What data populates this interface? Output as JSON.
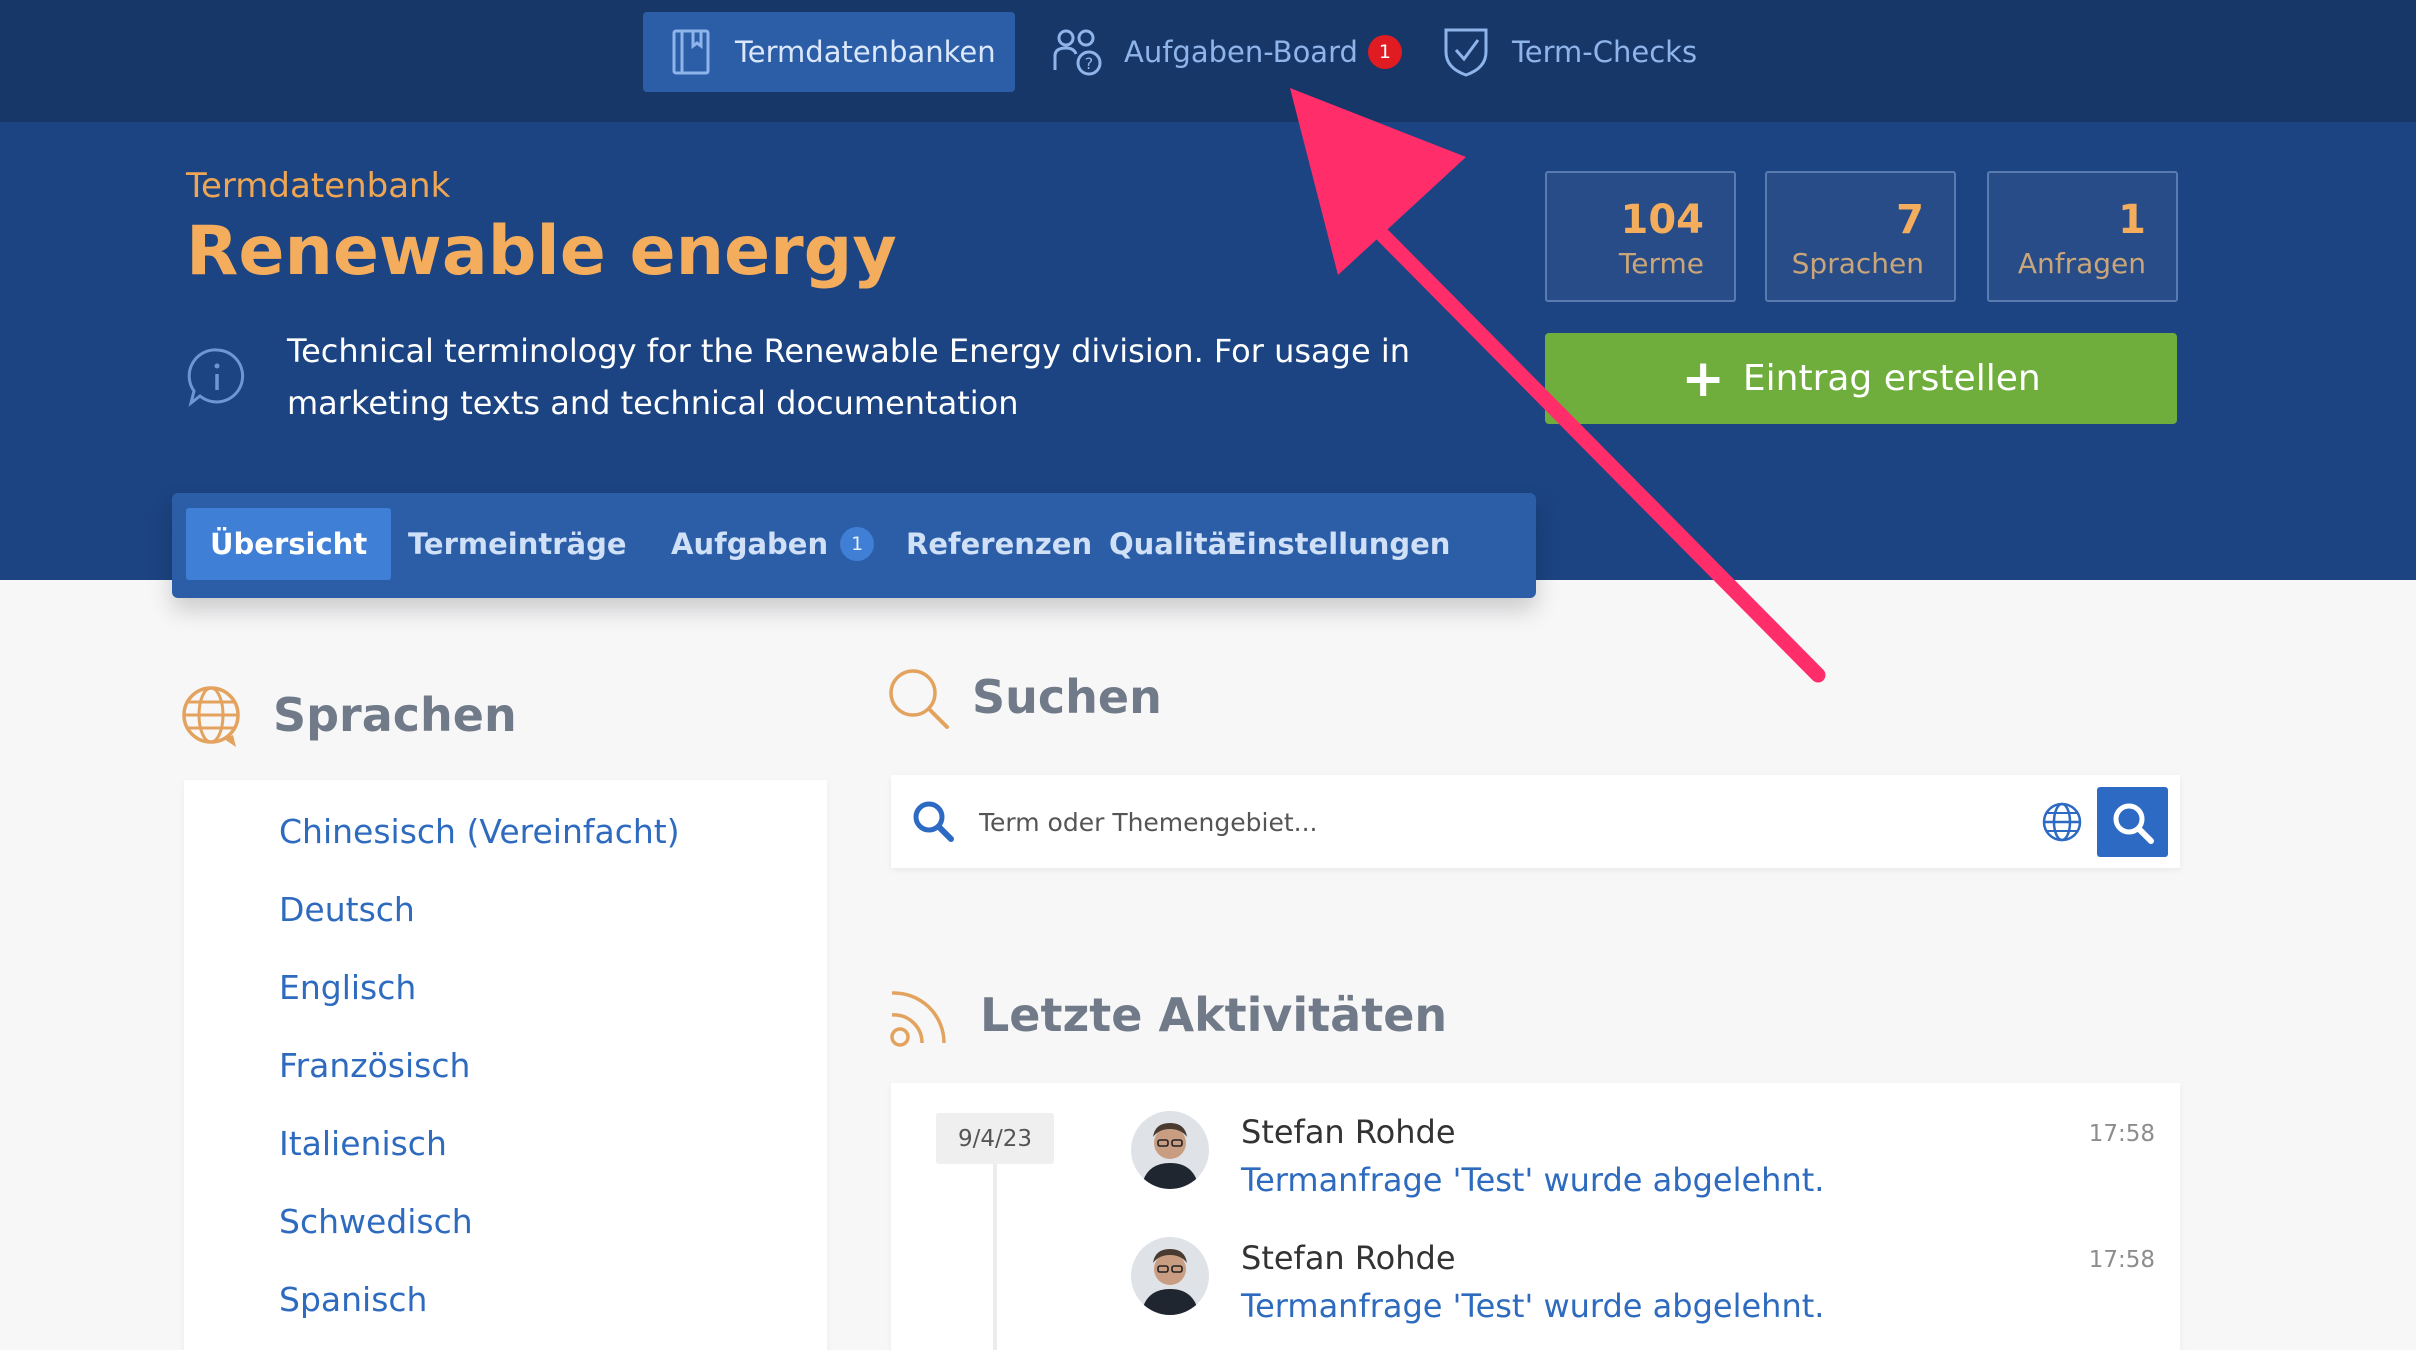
{
  "topnav": {
    "items": [
      {
        "label": "Termdatenbanken",
        "icon": "book-icon"
      },
      {
        "label": "Aufgaben-Board",
        "icon": "people-question-icon",
        "badge": "1"
      },
      {
        "label": "Term-Checks",
        "icon": "shield-check-icon"
      }
    ]
  },
  "header": {
    "label": "Termdatenbank",
    "title": "Renewable energy",
    "description": "Technical terminology for the Renewable Energy division. For usage in marketing texts and technical documentation",
    "stats": [
      {
        "value": "104",
        "label": "Terme"
      },
      {
        "value": "7",
        "label": "Sprachen"
      },
      {
        "value": "1",
        "label": "Anfragen"
      }
    ],
    "create_label": "Eintrag erstellen"
  },
  "tabs": [
    {
      "label": "Übersicht"
    },
    {
      "label": "Termeinträge"
    },
    {
      "label": "Aufgaben",
      "badge": "1"
    },
    {
      "label": "Referenzen"
    },
    {
      "label": "Qualität"
    },
    {
      "label": "Einstellungen"
    }
  ],
  "languages": {
    "title": "Sprachen",
    "items": [
      "Chinesisch (Vereinfacht)",
      "Deutsch",
      "Englisch",
      "Französisch",
      "Italienisch",
      "Schwedisch",
      "Spanisch"
    ]
  },
  "search": {
    "title": "Suchen",
    "placeholder": "Term oder Themengebiet..."
  },
  "activity": {
    "title": "Letzte Aktivitäten",
    "date": "9/4/23",
    "entries": [
      {
        "name": "Stefan Rohde",
        "text": "Termanfrage 'Test' wurde abgelehnt.",
        "time": "17:58"
      },
      {
        "name": "Stefan Rohde",
        "text": "Termanfrage 'Test' wurde abgelehnt.",
        "time": "17:58"
      }
    ]
  },
  "colors": {
    "nav_bg": "#173768",
    "header_bg": "#1c4482",
    "accent_orange": "#f4ad5c",
    "create_green": "#6fae3c",
    "link_blue": "#2e6bbf",
    "annotation_arrow": "#ff2d6a"
  }
}
